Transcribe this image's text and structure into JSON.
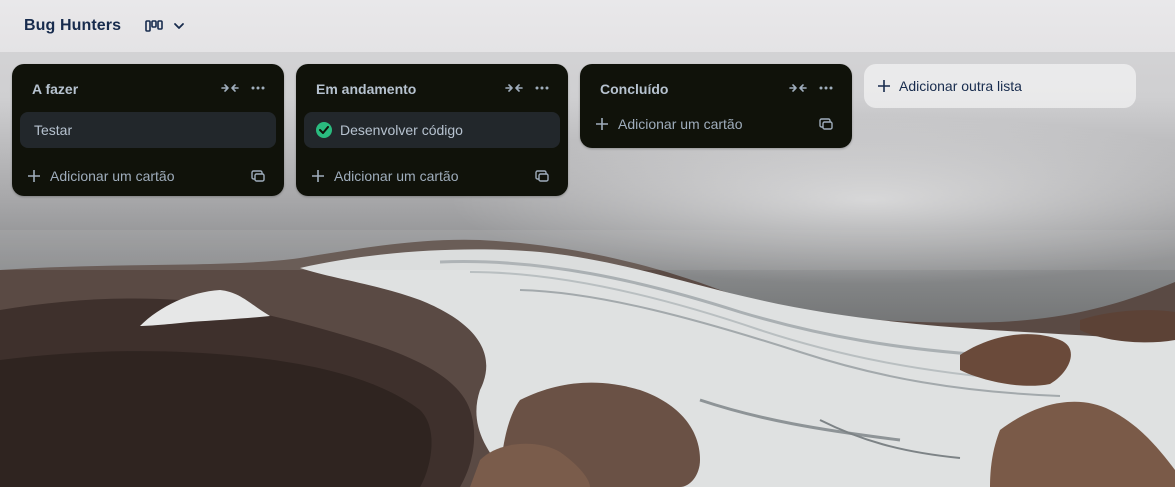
{
  "header": {
    "board_title": "Bug Hunters",
    "view_icon": "board-view-icon",
    "view_dropdown_icon": "chevron-down-icon"
  },
  "lists": [
    {
      "title": "A fazer",
      "cards": [
        {
          "title": "Testar",
          "completed": false
        }
      ],
      "add_card_label": "Adicionar um cartão"
    },
    {
      "title": "Em andamento",
      "cards": [
        {
          "title": "Desenvolver código",
          "completed": true
        }
      ],
      "add_card_label": "Adicionar um cartão"
    },
    {
      "title": "Concluído",
      "cards": [],
      "add_card_label": "Adicionar um cartão"
    }
  ],
  "add_list_label": "Adicionar outra lista",
  "colors": {
    "list_bg": "#10120a",
    "card_bg": "#22272b",
    "text_light": "#b6c2cf",
    "title_dark": "#172b4d",
    "complete_green": "#2abb7f"
  }
}
